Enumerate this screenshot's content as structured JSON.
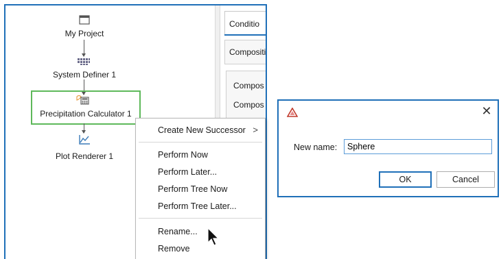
{
  "tree": {
    "nodes": [
      {
        "label": "My Project",
        "icon": "window-icon"
      },
      {
        "label": "System Definer 1",
        "icon": "grid-icon"
      },
      {
        "label": "Precipitation Calculator 1",
        "icon": "calculator-icon"
      },
      {
        "label": "Plot Renderer 1",
        "icon": "line-chart-icon"
      }
    ],
    "selected": "Precipitation Calculator 1"
  },
  "right_pane": {
    "tab_label": "Conditio",
    "group_label": "Compositi",
    "row1": "Compos",
    "row2": "Compos"
  },
  "context_menu": {
    "items": [
      {
        "label": "Create New Successor",
        "has_submenu": true
      },
      {
        "label": "Perform Now"
      },
      {
        "label": "Perform Later..."
      },
      {
        "label": "Perform Tree Now"
      },
      {
        "label": "Perform Tree Later..."
      },
      {
        "label": "Rename..."
      },
      {
        "label": "Remove"
      }
    ],
    "submenu_arrow": ">"
  },
  "dialog": {
    "title_icon": "app-logo-icon",
    "close_glyph": "✕",
    "name_label": "New name:",
    "name_value": "Sphere",
    "ok_label": "OK",
    "cancel_label": "Cancel"
  },
  "colors": {
    "window_border": "#1e6fb8",
    "selection_border": "#5db85a",
    "logo": "#c0392b"
  }
}
